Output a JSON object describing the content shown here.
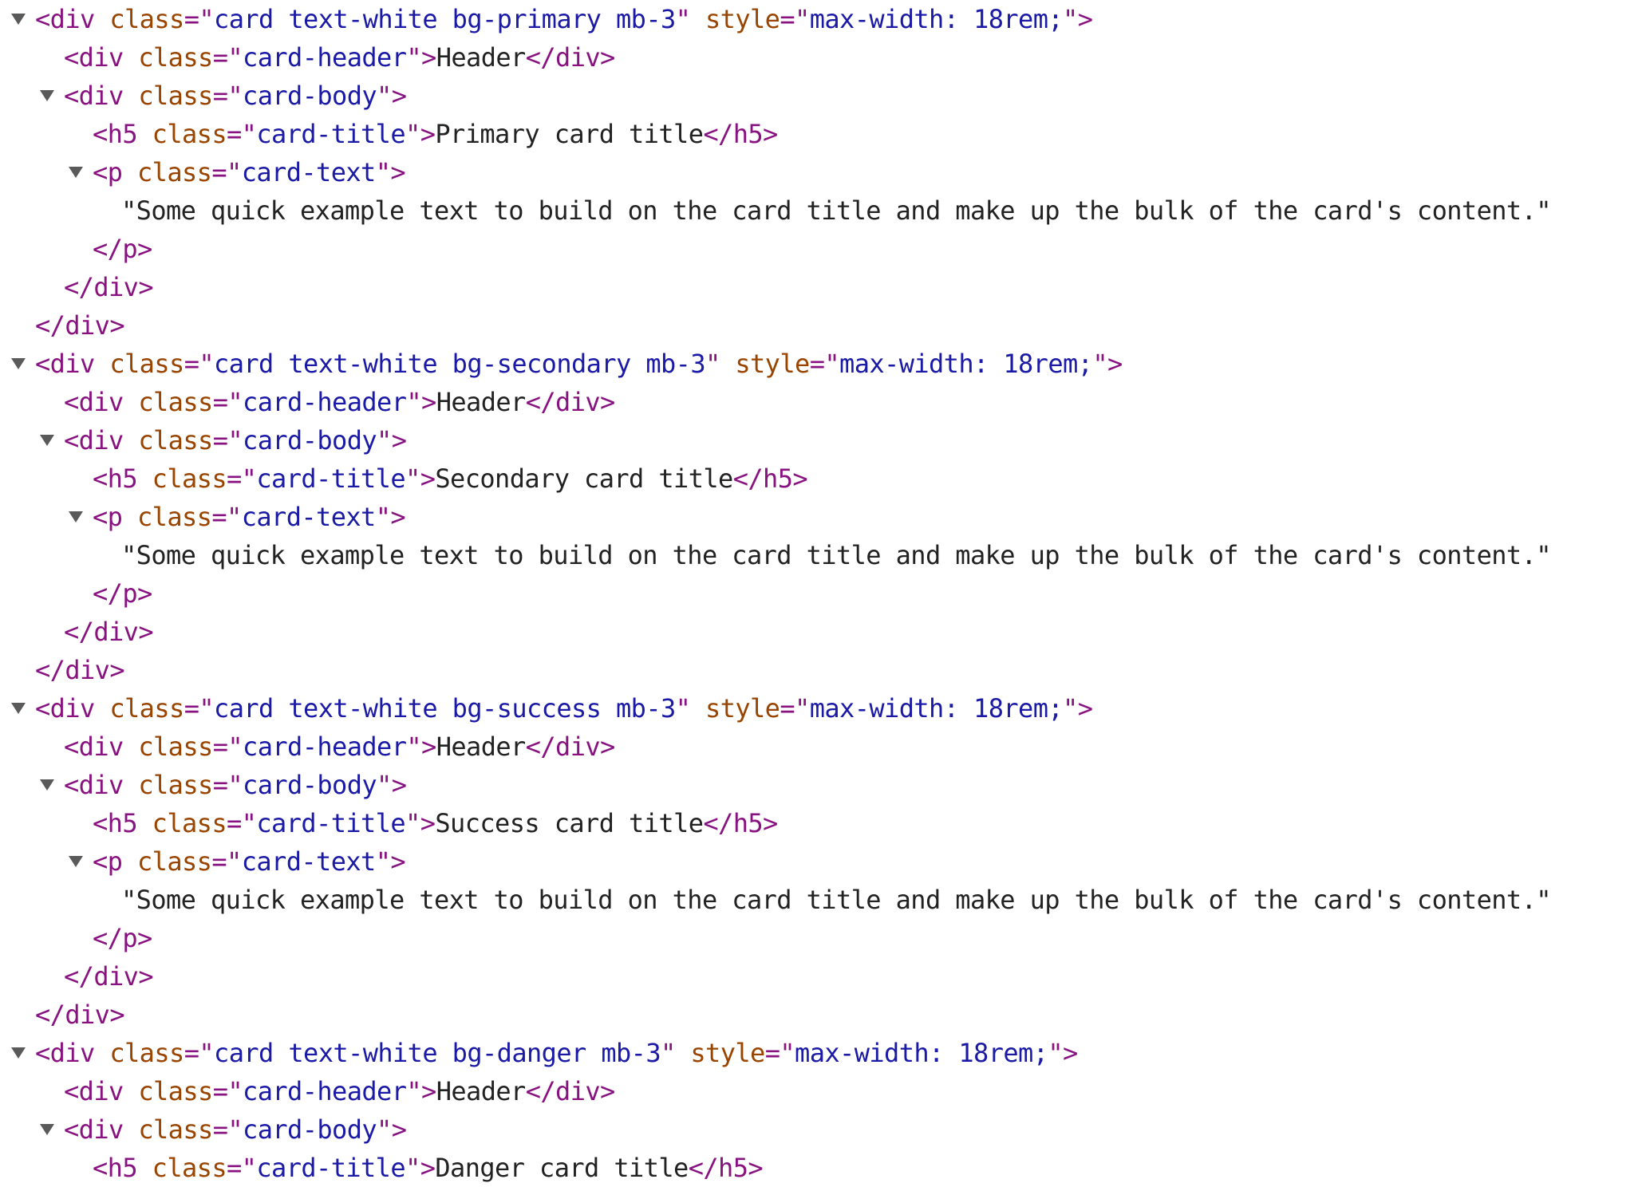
{
  "colors": {
    "tag": "#881280",
    "attr_name": "#994500",
    "attr_value": "#1a1aa6",
    "text": "#222222",
    "disclosure": "#5a5a5a"
  },
  "lines": [
    {
      "depth": 0,
      "expand": true,
      "segs": [
        [
          "tag",
          "<div"
        ],
        [
          "sp",
          " "
        ],
        [
          "attr",
          "class"
        ],
        [
          "eq",
          "=\""
        ],
        [
          "val",
          "card text-white bg-primary mb-3"
        ],
        [
          "eq",
          "\""
        ],
        [
          "sp",
          " "
        ],
        [
          "attr",
          "style"
        ],
        [
          "eq",
          "=\""
        ],
        [
          "val",
          "max-width: 18rem;"
        ],
        [
          "eq",
          "\">"
        ]
      ]
    },
    {
      "depth": 1,
      "expand": false,
      "segs": [
        [
          "tag",
          "<div"
        ],
        [
          "sp",
          " "
        ],
        [
          "attr",
          "class"
        ],
        [
          "eq",
          "=\""
        ],
        [
          "val",
          "card-header"
        ],
        [
          "eq",
          "\">"
        ],
        [
          "txt",
          "Header"
        ],
        [
          "tag",
          "</div>"
        ]
      ]
    },
    {
      "depth": 1,
      "expand": true,
      "segs": [
        [
          "tag",
          "<div"
        ],
        [
          "sp",
          " "
        ],
        [
          "attr",
          "class"
        ],
        [
          "eq",
          "=\""
        ],
        [
          "val",
          "card-body"
        ],
        [
          "eq",
          "\">"
        ]
      ]
    },
    {
      "depth": 2,
      "expand": false,
      "segs": [
        [
          "tag",
          "<h5"
        ],
        [
          "sp",
          " "
        ],
        [
          "attr",
          "class"
        ],
        [
          "eq",
          "=\""
        ],
        [
          "val",
          "card-title"
        ],
        [
          "eq",
          "\">"
        ],
        [
          "txt",
          "Primary card title"
        ],
        [
          "tag",
          "</h5>"
        ]
      ]
    },
    {
      "depth": 2,
      "expand": true,
      "segs": [
        [
          "tag",
          "<p"
        ],
        [
          "sp",
          " "
        ],
        [
          "attr",
          "class"
        ],
        [
          "eq",
          "=\""
        ],
        [
          "val",
          "card-text"
        ],
        [
          "eq",
          "\">"
        ]
      ]
    },
    {
      "depth": 3,
      "expand": false,
      "segs": [
        [
          "txt",
          "\"Some quick example text to build on the card title and make up the bulk of the card's content.\""
        ]
      ]
    },
    {
      "depth": 2,
      "expand": false,
      "segs": [
        [
          "tag",
          "</p>"
        ]
      ]
    },
    {
      "depth": 1,
      "expand": false,
      "segs": [
        [
          "tag",
          "</div>"
        ]
      ]
    },
    {
      "depth": 0,
      "expand": false,
      "segs": [
        [
          "tag",
          "</div>"
        ]
      ]
    },
    {
      "depth": 0,
      "expand": true,
      "segs": [
        [
          "tag",
          "<div"
        ],
        [
          "sp",
          " "
        ],
        [
          "attr",
          "class"
        ],
        [
          "eq",
          "=\""
        ],
        [
          "val",
          "card text-white bg-secondary mb-3"
        ],
        [
          "eq",
          "\""
        ],
        [
          "sp",
          " "
        ],
        [
          "attr",
          "style"
        ],
        [
          "eq",
          "=\""
        ],
        [
          "val",
          "max-width: 18rem;"
        ],
        [
          "eq",
          "\">"
        ]
      ]
    },
    {
      "depth": 1,
      "expand": false,
      "segs": [
        [
          "tag",
          "<div"
        ],
        [
          "sp",
          " "
        ],
        [
          "attr",
          "class"
        ],
        [
          "eq",
          "=\""
        ],
        [
          "val",
          "card-header"
        ],
        [
          "eq",
          "\">"
        ],
        [
          "txt",
          "Header"
        ],
        [
          "tag",
          "</div>"
        ]
      ]
    },
    {
      "depth": 1,
      "expand": true,
      "segs": [
        [
          "tag",
          "<div"
        ],
        [
          "sp",
          " "
        ],
        [
          "attr",
          "class"
        ],
        [
          "eq",
          "=\""
        ],
        [
          "val",
          "card-body"
        ],
        [
          "eq",
          "\">"
        ]
      ]
    },
    {
      "depth": 2,
      "expand": false,
      "segs": [
        [
          "tag",
          "<h5"
        ],
        [
          "sp",
          " "
        ],
        [
          "attr",
          "class"
        ],
        [
          "eq",
          "=\""
        ],
        [
          "val",
          "card-title"
        ],
        [
          "eq",
          "\">"
        ],
        [
          "txt",
          "Secondary card title"
        ],
        [
          "tag",
          "</h5>"
        ]
      ]
    },
    {
      "depth": 2,
      "expand": true,
      "segs": [
        [
          "tag",
          "<p"
        ],
        [
          "sp",
          " "
        ],
        [
          "attr",
          "class"
        ],
        [
          "eq",
          "=\""
        ],
        [
          "val",
          "card-text"
        ],
        [
          "eq",
          "\">"
        ]
      ]
    },
    {
      "depth": 3,
      "expand": false,
      "segs": [
        [
          "txt",
          "\"Some quick example text to build on the card title and make up the bulk of the card's content.\""
        ]
      ]
    },
    {
      "depth": 2,
      "expand": false,
      "segs": [
        [
          "tag",
          "</p>"
        ]
      ]
    },
    {
      "depth": 1,
      "expand": false,
      "segs": [
        [
          "tag",
          "</div>"
        ]
      ]
    },
    {
      "depth": 0,
      "expand": false,
      "segs": [
        [
          "tag",
          "</div>"
        ]
      ]
    },
    {
      "depth": 0,
      "expand": true,
      "segs": [
        [
          "tag",
          "<div"
        ],
        [
          "sp",
          " "
        ],
        [
          "attr",
          "class"
        ],
        [
          "eq",
          "=\""
        ],
        [
          "val",
          "card text-white bg-success mb-3"
        ],
        [
          "eq",
          "\""
        ],
        [
          "sp",
          " "
        ],
        [
          "attr",
          "style"
        ],
        [
          "eq",
          "=\""
        ],
        [
          "val",
          "max-width: 18rem;"
        ],
        [
          "eq",
          "\">"
        ]
      ]
    },
    {
      "depth": 1,
      "expand": false,
      "segs": [
        [
          "tag",
          "<div"
        ],
        [
          "sp",
          " "
        ],
        [
          "attr",
          "class"
        ],
        [
          "eq",
          "=\""
        ],
        [
          "val",
          "card-header"
        ],
        [
          "eq",
          "\">"
        ],
        [
          "txt",
          "Header"
        ],
        [
          "tag",
          "</div>"
        ]
      ]
    },
    {
      "depth": 1,
      "expand": true,
      "segs": [
        [
          "tag",
          "<div"
        ],
        [
          "sp",
          " "
        ],
        [
          "attr",
          "class"
        ],
        [
          "eq",
          "=\""
        ],
        [
          "val",
          "card-body"
        ],
        [
          "eq",
          "\">"
        ]
      ]
    },
    {
      "depth": 2,
      "expand": false,
      "segs": [
        [
          "tag",
          "<h5"
        ],
        [
          "sp",
          " "
        ],
        [
          "attr",
          "class"
        ],
        [
          "eq",
          "=\""
        ],
        [
          "val",
          "card-title"
        ],
        [
          "eq",
          "\">"
        ],
        [
          "txt",
          "Success card title"
        ],
        [
          "tag",
          "</h5>"
        ]
      ]
    },
    {
      "depth": 2,
      "expand": true,
      "segs": [
        [
          "tag",
          "<p"
        ],
        [
          "sp",
          " "
        ],
        [
          "attr",
          "class"
        ],
        [
          "eq",
          "=\""
        ],
        [
          "val",
          "card-text"
        ],
        [
          "eq",
          "\">"
        ]
      ]
    },
    {
      "depth": 3,
      "expand": false,
      "segs": [
        [
          "txt",
          "\"Some quick example text to build on the card title and make up the bulk of the card's content.\""
        ]
      ]
    },
    {
      "depth": 2,
      "expand": false,
      "segs": [
        [
          "tag",
          "</p>"
        ]
      ]
    },
    {
      "depth": 1,
      "expand": false,
      "segs": [
        [
          "tag",
          "</div>"
        ]
      ]
    },
    {
      "depth": 0,
      "expand": false,
      "segs": [
        [
          "tag",
          "</div>"
        ]
      ]
    },
    {
      "depth": 0,
      "expand": true,
      "segs": [
        [
          "tag",
          "<div"
        ],
        [
          "sp",
          " "
        ],
        [
          "attr",
          "class"
        ],
        [
          "eq",
          "=\""
        ],
        [
          "val",
          "card text-white bg-danger mb-3"
        ],
        [
          "eq",
          "\""
        ],
        [
          "sp",
          " "
        ],
        [
          "attr",
          "style"
        ],
        [
          "eq",
          "=\""
        ],
        [
          "val",
          "max-width: 18rem;"
        ],
        [
          "eq",
          "\">"
        ]
      ]
    },
    {
      "depth": 1,
      "expand": false,
      "segs": [
        [
          "tag",
          "<div"
        ],
        [
          "sp",
          " "
        ],
        [
          "attr",
          "class"
        ],
        [
          "eq",
          "=\""
        ],
        [
          "val",
          "card-header"
        ],
        [
          "eq",
          "\">"
        ],
        [
          "txt",
          "Header"
        ],
        [
          "tag",
          "</div>"
        ]
      ]
    },
    {
      "depth": 1,
      "expand": true,
      "segs": [
        [
          "tag",
          "<div"
        ],
        [
          "sp",
          " "
        ],
        [
          "attr",
          "class"
        ],
        [
          "eq",
          "=\""
        ],
        [
          "val",
          "card-body"
        ],
        [
          "eq",
          "\">"
        ]
      ]
    },
    {
      "depth": 2,
      "expand": false,
      "segs": [
        [
          "tag",
          "<h5"
        ],
        [
          "sp",
          " "
        ],
        [
          "attr",
          "class"
        ],
        [
          "eq",
          "=\""
        ],
        [
          "val",
          "card-title"
        ],
        [
          "eq",
          "\">"
        ],
        [
          "txt",
          "Danger card title"
        ],
        [
          "tag",
          "</h5>"
        ]
      ]
    }
  ]
}
